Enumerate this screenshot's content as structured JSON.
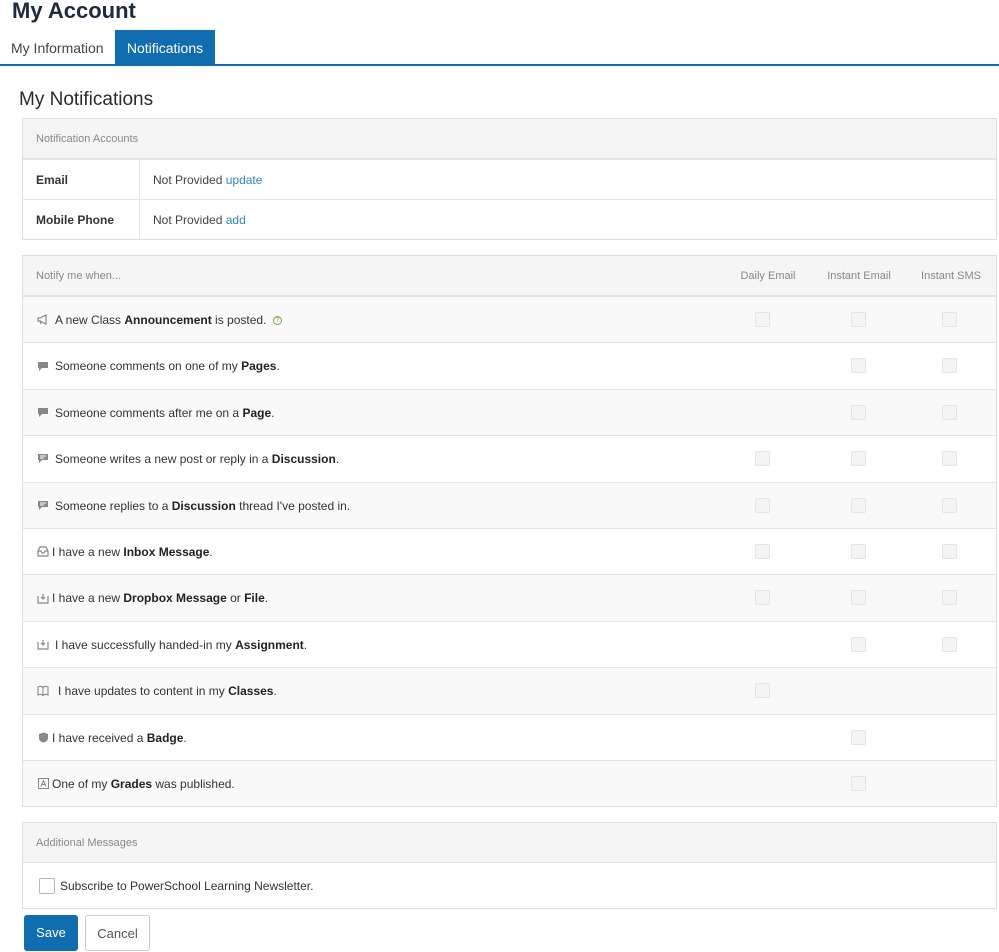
{
  "page": {
    "title": "My Account"
  },
  "tabs": [
    {
      "label": "My Information",
      "active": false
    },
    {
      "label": "Notifications",
      "active": true
    }
  ],
  "section": {
    "title": "My Notifications"
  },
  "accounts": {
    "header": "Notification Accounts",
    "rows": [
      {
        "label": "Email",
        "value": "Not Provided",
        "action": "update"
      },
      {
        "label": "Mobile Phone",
        "value": "Not Provided",
        "action": "add"
      }
    ]
  },
  "notify": {
    "header": "Notify me when...",
    "columns": [
      "Daily Email",
      "Instant Email",
      "Instant SMS"
    ],
    "rows": [
      {
        "icon": "megaphone-icon",
        "pre": "A new Class ",
        "bold": "Announcement",
        "post": " is posted.",
        "extra": "",
        "extra_bold": "",
        "end": "",
        "help": "?"
      },
      {
        "icon": "comment-icon",
        "pre": "Someone comments on one of my ",
        "bold": "Pages",
        "post": ".",
        "extra": "",
        "extra_bold": "",
        "end": ""
      },
      {
        "icon": "comment-icon",
        "pre": "Someone comments after me on a ",
        "bold": "Page",
        "post": ".",
        "extra": "",
        "extra_bold": "",
        "end": ""
      },
      {
        "icon": "discussion-icon",
        "pre": "Someone writes a new post or reply in a ",
        "bold": "Discussion",
        "post": ".",
        "extra": "",
        "extra_bold": "",
        "end": ""
      },
      {
        "icon": "discussion-icon",
        "pre": "Someone replies to a ",
        "bold": "Discussion",
        "post": " thread I've posted in.",
        "extra": "",
        "extra_bold": "",
        "end": ""
      },
      {
        "icon": "inbox-icon",
        "pre": "I have a new ",
        "bold": "Inbox Message",
        "post": ".",
        "extra": "",
        "extra_bold": "",
        "end": ""
      },
      {
        "icon": "dropbox-icon",
        "pre": "I have a new ",
        "bold": "Dropbox Message",
        "post": " or ",
        "extra_bold": "File",
        "end": "."
      },
      {
        "icon": "dropbox-icon",
        "pre": "I have successfully handed-in my ",
        "bold": "Assignment",
        "post": ".",
        "extra_bold": "",
        "end": ""
      },
      {
        "icon": "book-icon",
        "pre": "I have updates to content in my ",
        "bold": "Classes",
        "post": ".",
        "extra_bold": "",
        "end": ""
      },
      {
        "icon": "badge-icon",
        "pre": "I have received a ",
        "bold": "Badge",
        "post": ".",
        "extra_bold": "",
        "end": ""
      },
      {
        "icon": "grade-icon",
        "pre": "One of my ",
        "bold": "Grades",
        "post": " was published.",
        "extra_bold": "",
        "end": ""
      }
    ]
  },
  "additional": {
    "header": "Additional Messages",
    "subscribe_label": "Subscribe to PowerSchool Learning Newsletter."
  },
  "buttons": {
    "save": "Save",
    "cancel": "Cancel"
  },
  "colors": {
    "accent": "#0f6db0",
    "link": "#2d88c9"
  }
}
